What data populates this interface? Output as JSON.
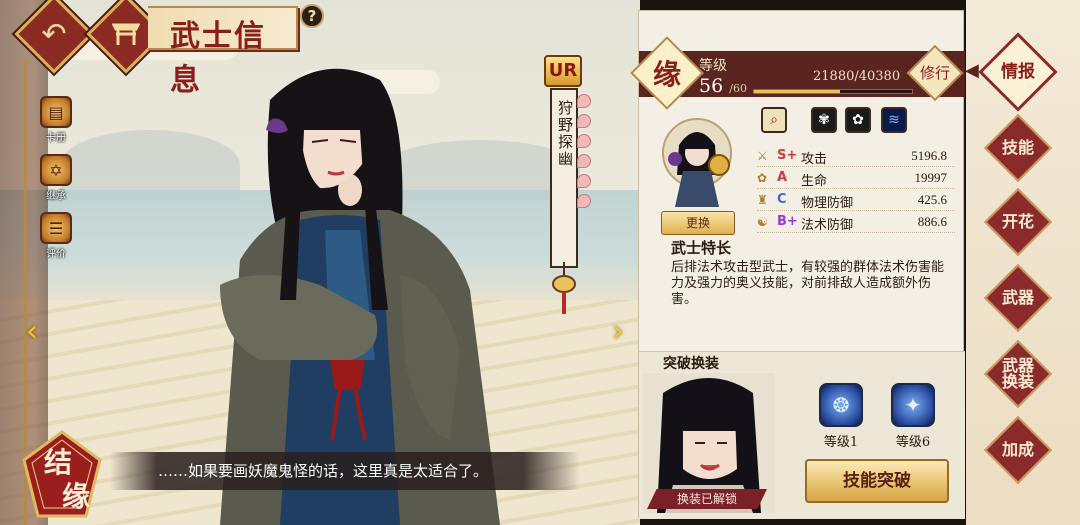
{
  "header": {
    "title": "武士信息",
    "help_label": "?"
  },
  "side_menu": [
    {
      "label": "卡册",
      "icon": "card-album-icon"
    },
    {
      "label": "继承",
      "icon": "inherit-icon"
    },
    {
      "label": "评价",
      "icon": "review-icon"
    }
  ],
  "character": {
    "rarity": "UR",
    "name": "狩野探幽",
    "dialogue": "……如果要画妖魔鬼怪的话，这里真是太适合了。"
  },
  "bond_button": {
    "label": "结缘"
  },
  "info": {
    "bond_badge": "缘",
    "level_label": "等级",
    "level": "56",
    "level_max": "/60",
    "exp_text": "21880/40380",
    "exp_ratio": 0.5419,
    "training_label": "修行",
    "swap_label": "更换",
    "stats": [
      {
        "grade": "S+",
        "name": "攻击",
        "value": "5196.8",
        "grade_color": "#d23a3a"
      },
      {
        "grade": "A",
        "name": "生命",
        "value": "19997",
        "grade_color": "#d23a3a"
      },
      {
        "grade": "C",
        "name": "物理防御",
        "value": "425.6",
        "grade_color": "#3a6ad0"
      },
      {
        "grade": "B+",
        "name": "法术防御",
        "value": "886.6",
        "grade_color": "#a03ad0"
      }
    ],
    "trait_title": "武士特长",
    "trait_text": "后排法术攻击型武士，有较强的群体法术伤害能力及强力的奥义技能，对前排敌人造成额外伤害。"
  },
  "breakthrough": {
    "title": "突破换装",
    "unlocked_label": "换装已解锁",
    "levels": [
      {
        "label": "等级1"
      },
      {
        "label": "等级6"
      }
    ],
    "button_label": "技能突破"
  },
  "tabs": [
    {
      "label": "情报",
      "active": true
    },
    {
      "label": "技能",
      "active": false
    },
    {
      "label": "开花",
      "active": false
    },
    {
      "label": "武器",
      "active": false
    },
    {
      "label": "武器\n换装",
      "active": false
    },
    {
      "label": "加成",
      "active": false
    }
  ]
}
